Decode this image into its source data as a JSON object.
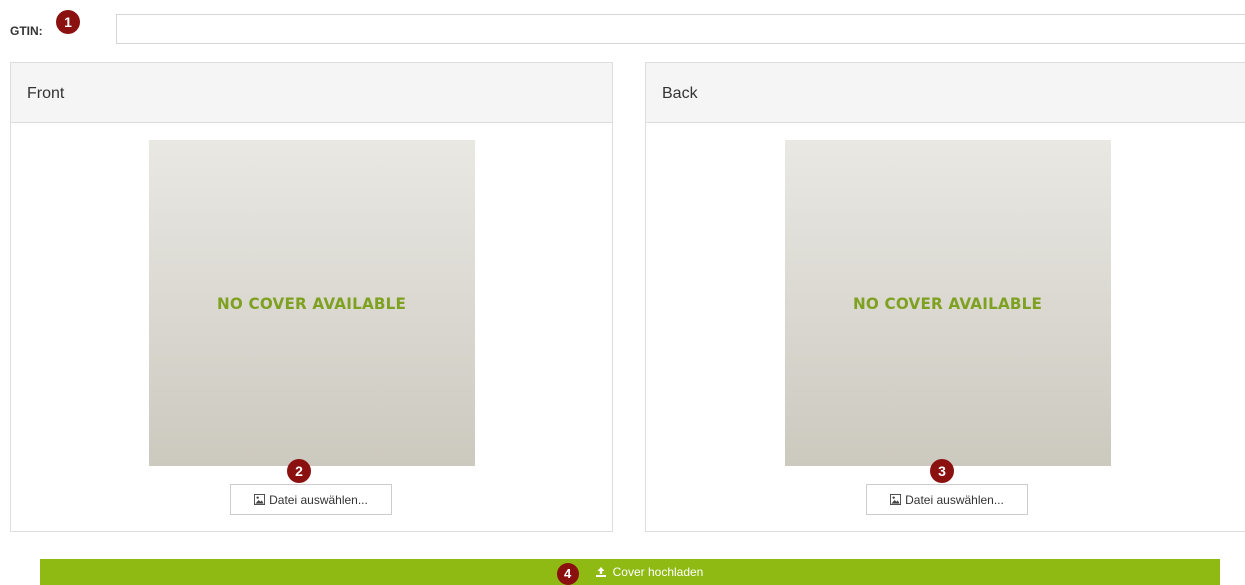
{
  "gtin": {
    "label": "GTIN:",
    "badge": "1",
    "value": ""
  },
  "front": {
    "title": "Front",
    "cover_text": "NO COVER AVAILABLE",
    "file_button_label": "Datei auswählen...",
    "badge": "2"
  },
  "back": {
    "title": "Back",
    "cover_text": "NO COVER AVAILABLE",
    "file_button_label": "Datei auswählen...",
    "badge": "3"
  },
  "upload": {
    "label": "Cover hochladen",
    "badge": "4",
    "icon": "upload-icon"
  },
  "icons": {
    "file_button": "image-icon"
  },
  "colors": {
    "badge": "#8b1111",
    "upload_bar": "#8fba14",
    "cover_text": "#7fa121"
  }
}
